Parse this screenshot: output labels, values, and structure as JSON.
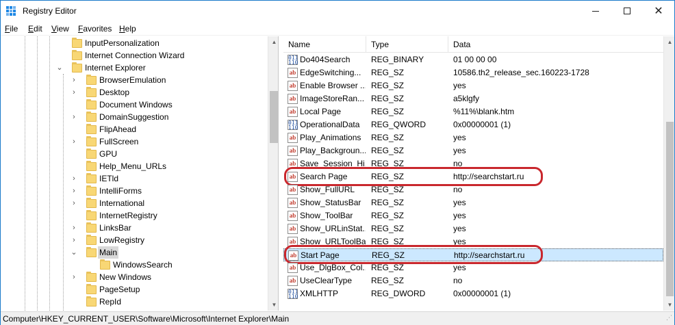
{
  "window": {
    "title": "Registry Editor"
  },
  "menu": [
    {
      "label": "File",
      "accel": "F",
      "rest": "ile"
    },
    {
      "label": "Edit",
      "accel": "E",
      "rest": "dit"
    },
    {
      "label": "View",
      "accel": "V",
      "rest": "iew"
    },
    {
      "label": "Favorites",
      "accel": "F",
      "rest": "avorites"
    },
    {
      "label": "Help",
      "accel": "H",
      "rest": "elp"
    }
  ],
  "tree": [
    {
      "label": "InputPersonalization",
      "level": 2,
      "chevron": ""
    },
    {
      "label": "Internet Connection Wizard",
      "level": 2,
      "chevron": ""
    },
    {
      "label": "Internet Explorer",
      "level": 2,
      "chevron": "v"
    },
    {
      "label": "BrowserEmulation",
      "level": 3,
      "chevron": ">"
    },
    {
      "label": "Desktop",
      "level": 3,
      "chevron": ">"
    },
    {
      "label": "Document Windows",
      "level": 3,
      "chevron": ""
    },
    {
      "label": "DomainSuggestion",
      "level": 3,
      "chevron": ">"
    },
    {
      "label": "FlipAhead",
      "level": 3,
      "chevron": ""
    },
    {
      "label": "FullScreen",
      "level": 3,
      "chevron": ">"
    },
    {
      "label": "GPU",
      "level": 3,
      "chevron": ""
    },
    {
      "label": "Help_Menu_URLs",
      "level": 3,
      "chevron": ""
    },
    {
      "label": "IETld",
      "level": 3,
      "chevron": ">"
    },
    {
      "label": "IntelliForms",
      "level": 3,
      "chevron": ">"
    },
    {
      "label": "International",
      "level": 3,
      "chevron": ">"
    },
    {
      "label": "InternetRegistry",
      "level": 3,
      "chevron": ""
    },
    {
      "label": "LinksBar",
      "level": 3,
      "chevron": ">"
    },
    {
      "label": "LowRegistry",
      "level": 3,
      "chevron": ">"
    },
    {
      "label": "Main",
      "level": 3,
      "chevron": "v",
      "selected": true
    },
    {
      "label": "WindowsSearch",
      "level": 4,
      "chevron": ""
    },
    {
      "label": "New Windows",
      "level": 3,
      "chevron": ">"
    },
    {
      "label": "PageSetup",
      "level": 3,
      "chevron": ""
    },
    {
      "label": "RepId",
      "level": 3,
      "chevron": ""
    }
  ],
  "columns": {
    "name": "Name",
    "type": "Type",
    "data": "Data"
  },
  "values": [
    {
      "name": "Do404Search",
      "type": "REG_BINARY",
      "data": "01 00 00 00",
      "icon": "bin"
    },
    {
      "name": "EdgeSwitching...",
      "type": "REG_SZ",
      "data": "10586.th2_release_sec.160223-1728",
      "icon": "sz"
    },
    {
      "name": "Enable Browser ...",
      "type": "REG_SZ",
      "data": "yes",
      "icon": "sz"
    },
    {
      "name": "ImageStoreRan...",
      "type": "REG_SZ",
      "data": "a5klgfy",
      "icon": "sz"
    },
    {
      "name": "Local Page",
      "type": "REG_SZ",
      "data": "%11%\\blank.htm",
      "icon": "sz"
    },
    {
      "name": "OperationalData",
      "type": "REG_QWORD",
      "data": "0x00000001 (1)",
      "icon": "bin"
    },
    {
      "name": "Play_Animations",
      "type": "REG_SZ",
      "data": "yes",
      "icon": "sz"
    },
    {
      "name": "Play_Backgroun...",
      "type": "REG_SZ",
      "data": "yes",
      "icon": "sz"
    },
    {
      "name": "Save_Session_Hi...",
      "type": "REG_SZ",
      "data": "no",
      "icon": "sz"
    },
    {
      "name": "Search Page",
      "type": "REG_SZ",
      "data": "http://searchstart.ru",
      "icon": "sz",
      "ring": true
    },
    {
      "name": "Show_FullURL",
      "type": "REG_SZ",
      "data": "no",
      "icon": "sz"
    },
    {
      "name": "Show_StatusBar",
      "type": "REG_SZ",
      "data": "yes",
      "icon": "sz"
    },
    {
      "name": "Show_ToolBar",
      "type": "REG_SZ",
      "data": "yes",
      "icon": "sz"
    },
    {
      "name": "Show_URLinStat...",
      "type": "REG_SZ",
      "data": "yes",
      "icon": "sz"
    },
    {
      "name": "Show_URLToolBar",
      "type": "REG_SZ",
      "data": "yes",
      "icon": "sz"
    },
    {
      "name": "Start Page",
      "type": "REG_SZ",
      "data": "http://searchstart.ru",
      "icon": "sz",
      "ring": true,
      "selected": true
    },
    {
      "name": "Use_DlgBox_Col...",
      "type": "REG_SZ",
      "data": "yes",
      "icon": "sz"
    },
    {
      "name": "UseClearType",
      "type": "REG_SZ",
      "data": "no",
      "icon": "sz"
    },
    {
      "name": "XMLHTTP",
      "type": "REG_DWORD",
      "data": "0x00000001 (1)",
      "icon": "bin"
    }
  ],
  "icon_glyphs": {
    "sz": "ab",
    "bin": "011\n110"
  },
  "status": {
    "path": "Computer\\HKEY_CURRENT_USER\\Software\\Microsoft\\Internet Explorer\\Main"
  },
  "colors": {
    "highlight_ring": "#c9272d",
    "selection": "#cce8ff",
    "folder": "#f8d775"
  }
}
